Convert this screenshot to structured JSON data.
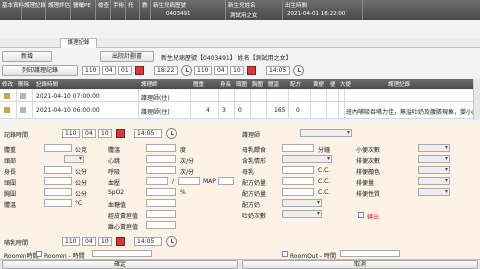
{
  "header": {
    "menu": [
      "基本資料",
      "護理記錄",
      "護理評估",
      "醫囑PE",
      "檢查",
      "手術",
      "托",
      "教",
      "新生兒病歷號",
      "新生兒姓名",
      "出生時間"
    ],
    "chart_no": "0403491",
    "name": "測試用之女",
    "birth_time": "2021-04-01 18:22:00"
  },
  "tab": "護理記錄",
  "buttons": {
    "add": "新增",
    "discharge_plan": "出院計劃書",
    "print_list": "列印護理記錄"
  },
  "patient_info": "新生兒病歷號【0403491】 姓名【測試用之女】",
  "print_range": {
    "from_y": "110",
    "from_m": "04",
    "from_d": "01",
    "from_t": "18:22",
    "to_y": "110",
    "to_m": "04",
    "to_d": "10",
    "to_t": "14:05"
  },
  "grid": {
    "headers": [
      "修改",
      "刪除",
      "記錄時間",
      "",
      "護理師",
      "",
      "體重",
      "",
      "身長",
      "頭圍",
      "胸圍",
      "體溫",
      "",
      "配方",
      "",
      "糞便",
      "便",
      "大便",
      "",
      "",
      "護理記錄"
    ],
    "rows": [
      {
        "time": "2021-04-10 07:00:00",
        "nurse": "護理師(住)",
        "vals": [],
        "note": ""
      },
      {
        "time": "2021-04-10 06:00:00",
        "nurse": "護理師(住)",
        "vals": [
          "4",
          "3",
          "0",
          "165",
          "0"
        ],
        "note": "班內哺吸吞嚥力佳，無溢吐奶及腹脹現象，嬰小床安睡中"
      }
    ]
  },
  "form": {
    "record_time_label": "記錄時間",
    "record_time": {
      "y": "110",
      "m": "04",
      "d": "10",
      "t": "14:05"
    },
    "nurse_label": "護理師",
    "left_labels": [
      "體重",
      "頭部",
      "身長",
      "頭圍",
      "胸圍",
      "體溫"
    ],
    "left_units": [
      "公克",
      "",
      "公分",
      "公分",
      "公分",
      "°C"
    ],
    "mid_labels": [
      "體溫",
      "心跳",
      "呼吸",
      "血壓",
      "SpO2",
      "血糖值",
      "經皮黃疸值",
      "離心黃疸值"
    ],
    "mid_units": [
      "度",
      "次/分",
      "次/分",
      "/",
      "%",
      "",
      "",
      ""
    ],
    "map_label": "MAP",
    "mid2_labels": [
      "母乳餵食",
      "含乳情形",
      "母乳",
      "配方奶量",
      "配方奶量",
      "配方奶",
      "吐奶次數"
    ],
    "mid2_units": [
      "分鐘",
      "",
      "C.C.",
      "C.C.",
      "C.C.",
      "",
      ""
    ],
    "right_labels": [
      "小便次數",
      "排便次數",
      "排便顏色",
      "排便量",
      "排便性質"
    ],
    "bleed_label": "轉出",
    "feed_time_label": "哺乳時間",
    "feed_time": {
      "y": "110",
      "m": "04",
      "d": "10",
      "t": "14:05"
    },
    "rooming_in": "RoomIn時間",
    "rooming_in2": "RoomIn - 時間",
    "rooming_out": "RoomOut - 時間"
  },
  "bottom": {
    "confirm": "確定",
    "cancel": "取消"
  }
}
